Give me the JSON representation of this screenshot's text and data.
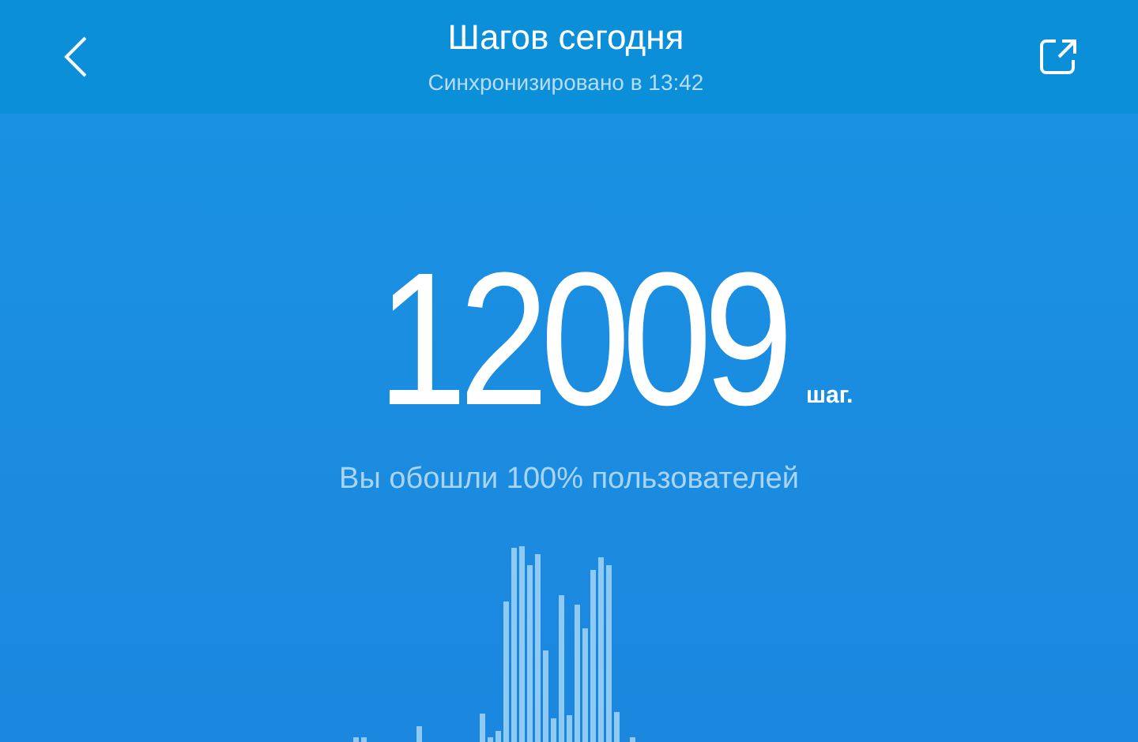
{
  "header": {
    "title": "Шагов сегодня",
    "subtitle": "Синхронизировано в 13:42"
  },
  "steps": {
    "value": "12009",
    "unit": "шаг."
  },
  "rank": "Вы обошли 100% пользователей"
}
